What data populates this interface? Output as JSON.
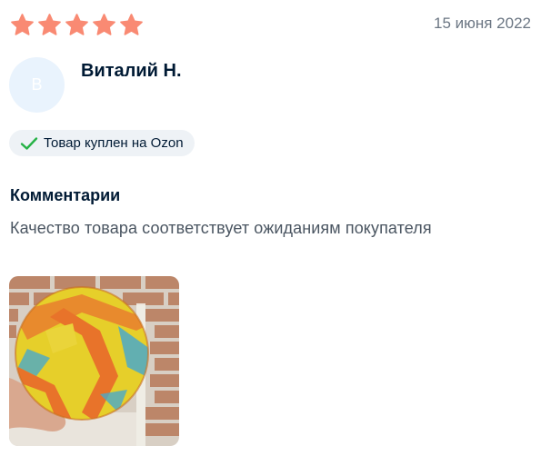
{
  "review": {
    "rating": 5,
    "rating_max": 5,
    "star_color": "#f98a73",
    "date": "15 июня 2022",
    "author": {
      "initial": "В",
      "name": "Виталий Н."
    },
    "badge": {
      "label": "Товар куплен на Ozon",
      "icon": "checkmark-icon",
      "icon_color": "#26b246"
    },
    "comments_title": "Комментарии",
    "comment_text": "Качество товара соответствует ожиданиям покупателя",
    "photos": [
      {
        "description_icon": "photo-thumbnail"
      }
    ]
  }
}
